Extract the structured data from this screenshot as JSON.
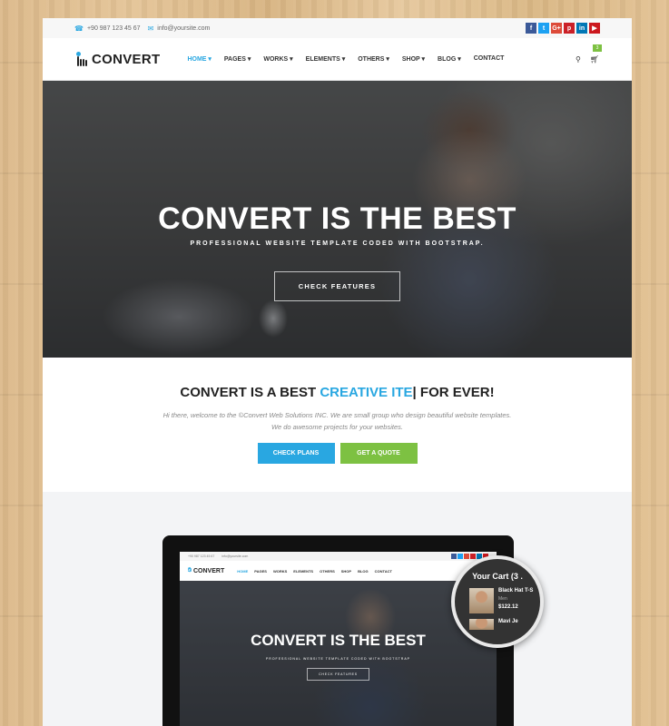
{
  "topbar": {
    "phone": "+90 987 123 45 67",
    "email": "info@yoursite.com",
    "social": [
      {
        "icon": "facebook-icon",
        "glyph": "f",
        "color": "#3b5998"
      },
      {
        "icon": "twitter-icon",
        "glyph": "t",
        "color": "#1da1f2"
      },
      {
        "icon": "google-plus-icon",
        "glyph": "G+",
        "color": "#dd4b39"
      },
      {
        "icon": "pinterest-icon",
        "glyph": "p",
        "color": "#cb2027"
      },
      {
        "icon": "linkedin-icon",
        "glyph": "in",
        "color": "#0077b5"
      },
      {
        "icon": "youtube-icon",
        "glyph": "▶",
        "color": "#cc181e"
      }
    ]
  },
  "nav": {
    "logo": "CONVERT",
    "items": [
      "HOME",
      "PAGES",
      "WORKS",
      "ELEMENTS",
      "OTHERS",
      "SHOP",
      "BLOG",
      "CONTACT"
    ],
    "cart_count": "3"
  },
  "hero": {
    "title": "CONVERT IS THE BEST",
    "subtitle": "PROFESSIONAL WEBSITE TEMPLATE CODED WITH BOOTSTRAP.",
    "button": "CHECK FEATURES"
  },
  "intro": {
    "title_prefix": "CONVERT IS A BEST ",
    "title_accent": "CREATIVE ITE",
    "title_suffix": "| FOR EVER!",
    "line1": "Hi there, welcome to the ©Convert Web Solutions INC. We are small group who design beautiful website templates.",
    "line2": "We do awesome projects for your websites.",
    "btn_plans": "CHECK PLANS",
    "btn_quote": "GET A QUOTE"
  },
  "colors": {
    "accent": "#29a7e1",
    "green": "#7dc142"
  },
  "mockup": {
    "phone": "+90 987 123 45 67",
    "email": "info@yoursite.com",
    "logo": "CONVERT",
    "menu": [
      "HOME",
      "PAGES",
      "WORKS",
      "ELEMENTS",
      "OTHERS",
      "SHOP",
      "BLOG",
      "CONTACT"
    ],
    "hero_title": "CONVERT IS THE BEST",
    "hero_subtitle": "PROFESSIONAL WEBSITE TEMPLATE CODED WITH BOOTSTRAP",
    "hero_button": "CHECK FEATURES"
  },
  "cart_popup": {
    "title": "Your Cart (3 .",
    "item1_name": "Black Hat T-S",
    "item1_meta": "Men",
    "item1_price": "$122.12",
    "item2_name": "Mavi Je"
  }
}
